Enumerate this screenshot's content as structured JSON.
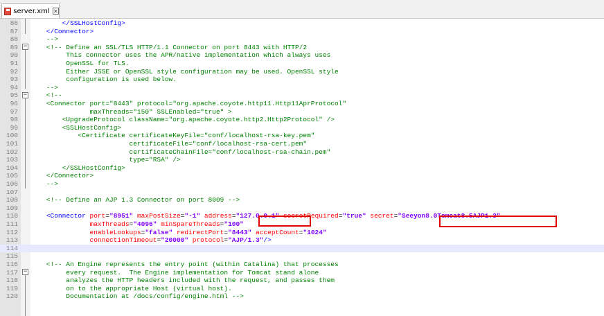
{
  "tab": {
    "filename": "server.xml",
    "close_glyph": "✕"
  },
  "colors": {
    "highlight": "#e00000",
    "tag": "#0000ff",
    "attribute": "#ff0000",
    "value": "#8000ff",
    "comment": "#008000",
    "current_line": "#e8e8ff"
  },
  "lines": [
    {
      "num": "86",
      "segs": [
        {
          "t": "        </SSLHostConfig>",
          "k": "tag"
        }
      ]
    },
    {
      "num": "87",
      "segs": [
        {
          "t": "    </Connector>",
          "k": "tag"
        }
      ]
    },
    {
      "num": "88",
      "segs": [
        {
          "t": "    -->",
          "k": "com"
        }
      ]
    },
    {
      "num": "89",
      "segs": [
        {
          "t": "    <!-- Define an SSL/TLS HTTP/1.1 Connector on port 8443 with HTTP/2",
          "k": "com"
        }
      ]
    },
    {
      "num": "90",
      "segs": [
        {
          "t": "         This connector uses the APR/native implementation which always uses",
          "k": "com"
        }
      ]
    },
    {
      "num": "91",
      "segs": [
        {
          "t": "         OpenSSL for TLS.",
          "k": "com"
        }
      ]
    },
    {
      "num": "92",
      "segs": [
        {
          "t": "         Either JSSE or OpenSSL style configuration may be used. OpenSSL style",
          "k": "com"
        }
      ]
    },
    {
      "num": "93",
      "segs": [
        {
          "t": "         configuration is used below.",
          "k": "com"
        }
      ]
    },
    {
      "num": "94",
      "segs": [
        {
          "t": "    -->",
          "k": "com"
        }
      ]
    },
    {
      "num": "95",
      "segs": [
        {
          "t": "    <!--",
          "k": "com"
        }
      ]
    },
    {
      "num": "96",
      "segs": [
        {
          "t": "    <Connector port=\"8443\" protocol=\"org.apache.coyote.http11.Http11AprProtocol\"",
          "k": "com"
        }
      ]
    },
    {
      "num": "97",
      "segs": [
        {
          "t": "               maxThreads=\"150\" SSLEnabled=\"true\" >",
          "k": "com"
        }
      ]
    },
    {
      "num": "98",
      "segs": [
        {
          "t": "        <UpgradeProtocol className=\"org.apache.coyote.http2.Http2Protocol\" />",
          "k": "com"
        }
      ]
    },
    {
      "num": "99",
      "segs": [
        {
          "t": "        <SSLHostConfig>",
          "k": "com"
        }
      ]
    },
    {
      "num": "100",
      "segs": [
        {
          "t": "            <Certificate certificateKeyFile=\"conf/localhost-rsa-key.pem\"",
          "k": "com"
        }
      ]
    },
    {
      "num": "101",
      "segs": [
        {
          "t": "                         certificateFile=\"conf/localhost-rsa-cert.pem\"",
          "k": "com"
        }
      ]
    },
    {
      "num": "102",
      "segs": [
        {
          "t": "                         certificateChainFile=\"conf/localhost-rsa-chain.pem\"",
          "k": "com"
        }
      ]
    },
    {
      "num": "103",
      "segs": [
        {
          "t": "                         type=\"RSA\" />",
          "k": "com"
        }
      ]
    },
    {
      "num": "104",
      "segs": [
        {
          "t": "        </SSLHostConfig>",
          "k": "com"
        }
      ]
    },
    {
      "num": "105",
      "segs": [
        {
          "t": "    </Connector>",
          "k": "com"
        }
      ]
    },
    {
      "num": "106",
      "segs": [
        {
          "t": "    -->",
          "k": "com"
        }
      ]
    },
    {
      "num": "107",
      "segs": [
        {
          "t": "",
          "k": "plain"
        }
      ]
    },
    {
      "num": "108",
      "segs": [
        {
          "t": "    <!-- Define an AJP 1.3 Connector on port 8009 -->",
          "k": "com"
        }
      ]
    },
    {
      "num": "109",
      "segs": [
        {
          "t": "",
          "k": "plain"
        }
      ]
    },
    {
      "num": "110",
      "segs": [
        {
          "t": "    ",
          "k": "plain"
        },
        {
          "t": "<Connector ",
          "k": "tag"
        },
        {
          "t": "port",
          "k": "attr"
        },
        {
          "t": "=",
          "k": "plain"
        },
        {
          "t": "\"8951\"",
          "k": "val"
        },
        {
          "t": " maxPostSize",
          "k": "attr"
        },
        {
          "t": "=",
          "k": "plain"
        },
        {
          "t": "\"-1\"",
          "k": "val"
        },
        {
          "t": " address",
          "k": "attr"
        },
        {
          "t": "=",
          "k": "plain"
        },
        {
          "t": "\"127.0.0.1\"",
          "k": "val"
        },
        {
          "t": " secretRequired",
          "k": "attr"
        },
        {
          "t": "=",
          "k": "plain"
        },
        {
          "t": "\"true\"",
          "k": "val"
        },
        {
          "t": " secret",
          "k": "attr"
        },
        {
          "t": "=",
          "k": "plain"
        },
        {
          "t": "\"Seeyon8.0Tomcat8.5AJP1.3\"",
          "k": "val"
        }
      ]
    },
    {
      "num": "111",
      "segs": [
        {
          "t": "               ",
          "k": "plain"
        },
        {
          "t": "maxThreads",
          "k": "attr"
        },
        {
          "t": "=",
          "k": "plain"
        },
        {
          "t": "\"4096\"",
          "k": "val"
        },
        {
          "t": " minSpareThreads",
          "k": "attr"
        },
        {
          "t": "=",
          "k": "plain"
        },
        {
          "t": "\"100\"",
          "k": "val"
        }
      ]
    },
    {
      "num": "112",
      "segs": [
        {
          "t": "               ",
          "k": "plain"
        },
        {
          "t": "enableLookups",
          "k": "attr"
        },
        {
          "t": "=",
          "k": "plain"
        },
        {
          "t": "\"false\"",
          "k": "val"
        },
        {
          "t": " redirectPort",
          "k": "attr"
        },
        {
          "t": "=",
          "k": "plain"
        },
        {
          "t": "\"8443\"",
          "k": "val"
        },
        {
          "t": " acceptCount",
          "k": "attr"
        },
        {
          "t": "=",
          "k": "plain"
        },
        {
          "t": "\"1024\"",
          "k": "val"
        }
      ]
    },
    {
      "num": "113",
      "segs": [
        {
          "t": "               ",
          "k": "plain"
        },
        {
          "t": "connectionTimeout",
          "k": "attr"
        },
        {
          "t": "=",
          "k": "plain"
        },
        {
          "t": "\"20000\"",
          "k": "val"
        },
        {
          "t": " protocol",
          "k": "attr"
        },
        {
          "t": "=",
          "k": "plain"
        },
        {
          "t": "\"AJP/1.3\"",
          "k": "val"
        },
        {
          "t": "/>",
          "k": "tag"
        }
      ]
    },
    {
      "num": "114",
      "segs": [
        {
          "t": "",
          "k": "plain"
        }
      ],
      "current": true
    },
    {
      "num": "115",
      "segs": [
        {
          "t": "",
          "k": "plain"
        }
      ]
    },
    {
      "num": "116",
      "segs": [
        {
          "t": "    <!-- An Engine represents the entry point (within Catalina) that processes",
          "k": "com"
        }
      ]
    },
    {
      "num": "117",
      "segs": [
        {
          "t": "         every request.  The Engine implementation for Tomcat stand alone",
          "k": "com"
        }
      ]
    },
    {
      "num": "118",
      "segs": [
        {
          "t": "         analyzes the HTTP headers included with the request, and passes them",
          "k": "com"
        }
      ]
    },
    {
      "num": "119",
      "segs": [
        {
          "t": "         on to the appropriate Host (virtual host).",
          "k": "com"
        }
      ]
    },
    {
      "num": "120",
      "segs": [
        {
          "t": "         Documentation at /docs/config/engine.html -->",
          "k": "com"
        }
      ]
    }
  ]
}
